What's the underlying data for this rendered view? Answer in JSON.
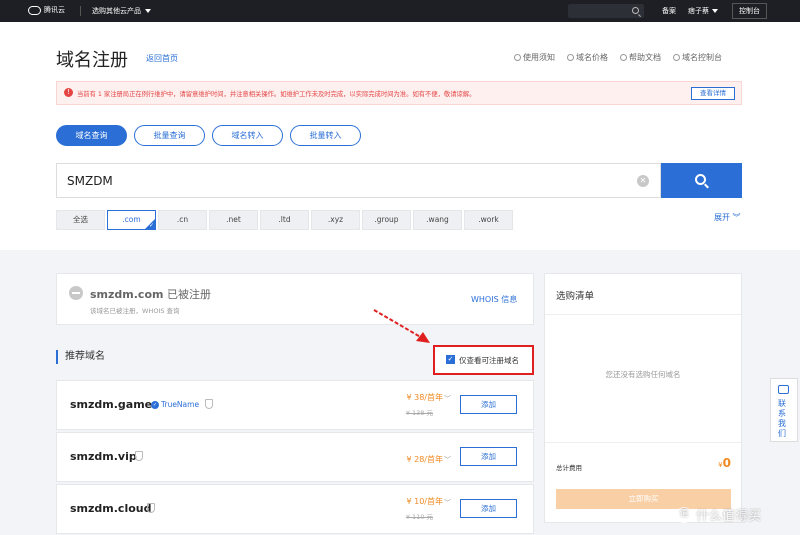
{
  "topbar": {
    "brand": "腾讯云",
    "product_menu": "选购其他云产品",
    "nav_record": "备案",
    "user": "痞子蔡",
    "console": "控制台"
  },
  "header": {
    "title": "域名注册",
    "back_link": "返回首页",
    "links": [
      "使用须知",
      "域名价格",
      "帮助文档",
      "域名控制台"
    ]
  },
  "notice": {
    "text": "当前有 1 家注册局正在例行维护中，请留意维护时间，并注意相关操作。如维护工作未及时完成，以实际完成时间为准。如有不便，敬请谅解。",
    "detail_button": "查看详情"
  },
  "modes": [
    "域名查询",
    "批量查询",
    "域名转入",
    "批量转入"
  ],
  "search": {
    "value": "SMZDM",
    "clear_symbol": "✕"
  },
  "tlds": [
    "全选",
    ".com",
    ".cn",
    ".net",
    ".ltd",
    ".xyz",
    ".group",
    ".wang",
    ".work"
  ],
  "expand_label": "展开",
  "status": {
    "domain_base": "smzdm",
    "domain_tld": ".com",
    "state": "已被注册",
    "sub": "该域名已被注册，WHOIS 查询",
    "whois_link": "WHOIS 信息"
  },
  "recommend": {
    "title": "推荐域名",
    "filter_label": "仅查看可注册域名",
    "trustname_label": "TrueName",
    "add_label": "添加",
    "rows": [
      {
        "domain": "smzdm.games",
        "price": "¥ 38/首年",
        "old": "¥ 138 元"
      },
      {
        "domain": "smzdm.vip",
        "price": "¥ 28/首年",
        "old": ""
      },
      {
        "domain": "smzdm.cloud",
        "price": "¥ 10/首年",
        "old": "¥ 110 元"
      }
    ]
  },
  "cart": {
    "title": "选购清单",
    "empty": "您还没有选购任何域名",
    "total_label": "总计费用",
    "currency": "¥",
    "amount": "0",
    "buy": "立即购买"
  },
  "sidebar": {
    "contact": "联系我们"
  },
  "watermark": {
    "text": "什么值得买",
    "symbol": "值"
  },
  "colors": {
    "accent": "#2b6fd6",
    "price": "#f08a24",
    "warning": "#e54545",
    "highlight": "#e02020"
  }
}
